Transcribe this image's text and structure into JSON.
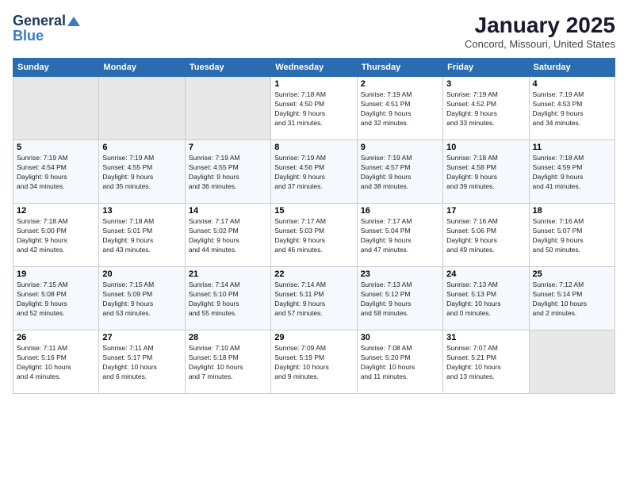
{
  "logo": {
    "line1": "General",
    "line2": "Blue"
  },
  "title": "January 2025",
  "subtitle": "Concord, Missouri, United States",
  "days_of_week": [
    "Sunday",
    "Monday",
    "Tuesday",
    "Wednesday",
    "Thursday",
    "Friday",
    "Saturday"
  ],
  "weeks": [
    [
      {
        "day": "",
        "info": ""
      },
      {
        "day": "",
        "info": ""
      },
      {
        "day": "",
        "info": ""
      },
      {
        "day": "1",
        "info": "Sunrise: 7:18 AM\nSunset: 4:50 PM\nDaylight: 9 hours\nand 31 minutes."
      },
      {
        "day": "2",
        "info": "Sunrise: 7:19 AM\nSunset: 4:51 PM\nDaylight: 9 hours\nand 32 minutes."
      },
      {
        "day": "3",
        "info": "Sunrise: 7:19 AM\nSunset: 4:52 PM\nDaylight: 9 hours\nand 33 minutes."
      },
      {
        "day": "4",
        "info": "Sunrise: 7:19 AM\nSunset: 4:53 PM\nDaylight: 9 hours\nand 34 minutes."
      }
    ],
    [
      {
        "day": "5",
        "info": "Sunrise: 7:19 AM\nSunset: 4:54 PM\nDaylight: 9 hours\nand 34 minutes."
      },
      {
        "day": "6",
        "info": "Sunrise: 7:19 AM\nSunset: 4:55 PM\nDaylight: 9 hours\nand 35 minutes."
      },
      {
        "day": "7",
        "info": "Sunrise: 7:19 AM\nSunset: 4:55 PM\nDaylight: 9 hours\nand 36 minutes."
      },
      {
        "day": "8",
        "info": "Sunrise: 7:19 AM\nSunset: 4:56 PM\nDaylight: 9 hours\nand 37 minutes."
      },
      {
        "day": "9",
        "info": "Sunrise: 7:19 AM\nSunset: 4:57 PM\nDaylight: 9 hours\nand 38 minutes."
      },
      {
        "day": "10",
        "info": "Sunrise: 7:18 AM\nSunset: 4:58 PM\nDaylight: 9 hours\nand 39 minutes."
      },
      {
        "day": "11",
        "info": "Sunrise: 7:18 AM\nSunset: 4:59 PM\nDaylight: 9 hours\nand 41 minutes."
      }
    ],
    [
      {
        "day": "12",
        "info": "Sunrise: 7:18 AM\nSunset: 5:00 PM\nDaylight: 9 hours\nand 42 minutes."
      },
      {
        "day": "13",
        "info": "Sunrise: 7:18 AM\nSunset: 5:01 PM\nDaylight: 9 hours\nand 43 minutes."
      },
      {
        "day": "14",
        "info": "Sunrise: 7:17 AM\nSunset: 5:02 PM\nDaylight: 9 hours\nand 44 minutes."
      },
      {
        "day": "15",
        "info": "Sunrise: 7:17 AM\nSunset: 5:03 PM\nDaylight: 9 hours\nand 46 minutes."
      },
      {
        "day": "16",
        "info": "Sunrise: 7:17 AM\nSunset: 5:04 PM\nDaylight: 9 hours\nand 47 minutes."
      },
      {
        "day": "17",
        "info": "Sunrise: 7:16 AM\nSunset: 5:06 PM\nDaylight: 9 hours\nand 49 minutes."
      },
      {
        "day": "18",
        "info": "Sunrise: 7:16 AM\nSunset: 5:07 PM\nDaylight: 9 hours\nand 50 minutes."
      }
    ],
    [
      {
        "day": "19",
        "info": "Sunrise: 7:15 AM\nSunset: 5:08 PM\nDaylight: 9 hours\nand 52 minutes."
      },
      {
        "day": "20",
        "info": "Sunrise: 7:15 AM\nSunset: 5:09 PM\nDaylight: 9 hours\nand 53 minutes."
      },
      {
        "day": "21",
        "info": "Sunrise: 7:14 AM\nSunset: 5:10 PM\nDaylight: 9 hours\nand 55 minutes."
      },
      {
        "day": "22",
        "info": "Sunrise: 7:14 AM\nSunset: 5:11 PM\nDaylight: 9 hours\nand 57 minutes."
      },
      {
        "day": "23",
        "info": "Sunrise: 7:13 AM\nSunset: 5:12 PM\nDaylight: 9 hours\nand 58 minutes."
      },
      {
        "day": "24",
        "info": "Sunrise: 7:13 AM\nSunset: 5:13 PM\nDaylight: 10 hours\nand 0 minutes."
      },
      {
        "day": "25",
        "info": "Sunrise: 7:12 AM\nSunset: 5:14 PM\nDaylight: 10 hours\nand 2 minutes."
      }
    ],
    [
      {
        "day": "26",
        "info": "Sunrise: 7:11 AM\nSunset: 5:16 PM\nDaylight: 10 hours\nand 4 minutes."
      },
      {
        "day": "27",
        "info": "Sunrise: 7:11 AM\nSunset: 5:17 PM\nDaylight: 10 hours\nand 6 minutes."
      },
      {
        "day": "28",
        "info": "Sunrise: 7:10 AM\nSunset: 5:18 PM\nDaylight: 10 hours\nand 7 minutes."
      },
      {
        "day": "29",
        "info": "Sunrise: 7:09 AM\nSunset: 5:19 PM\nDaylight: 10 hours\nand 9 minutes."
      },
      {
        "day": "30",
        "info": "Sunrise: 7:08 AM\nSunset: 5:20 PM\nDaylight: 10 hours\nand 11 minutes."
      },
      {
        "day": "31",
        "info": "Sunrise: 7:07 AM\nSunset: 5:21 PM\nDaylight: 10 hours\nand 13 minutes."
      },
      {
        "day": "",
        "info": ""
      }
    ]
  ]
}
